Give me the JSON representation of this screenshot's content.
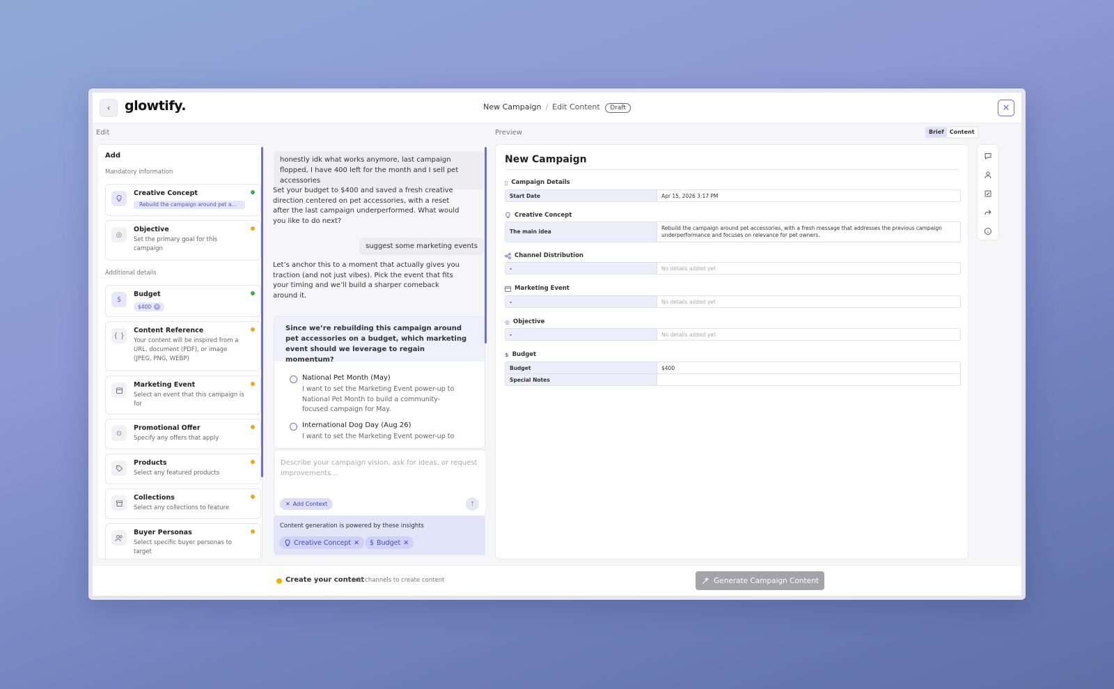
{
  "header": {
    "logo": "glowtify.",
    "breadcrumb_root": "New Campaign",
    "breadcrumb_sep": "/",
    "breadcrumb_current": "Edit Content",
    "status_badge": "Draft"
  },
  "panels": {
    "edit_label": "Edit",
    "preview_label": "Preview",
    "view_toggle": [
      "Brief",
      "Content"
    ],
    "view_toggle_selected": "Brief"
  },
  "sidebar": {
    "add_title": "Add",
    "mandatory_label": "Mandatory information",
    "additional_label": "Additional details",
    "items": [
      {
        "title": "Creative Concept",
        "chip": "Rebuild the campaign around pet accessories, with a fresh message",
        "status": "green",
        "icon": "lightbulb-icon"
      },
      {
        "title": "Objective",
        "desc": "Set the primary goal for this campaign",
        "status": "orange",
        "icon": "target-icon"
      },
      {
        "title": "Budget",
        "chip": "$400",
        "status": "green",
        "icon": "dollar-icon"
      },
      {
        "title": "Content Reference",
        "desc": "Your content will be inspired from a URL, document (PDF), or image (JPEG, PNG, WEBP)",
        "status": "orange",
        "icon": "braces-icon"
      },
      {
        "title": "Marketing Event",
        "desc": "Select an event that this campaign is for",
        "status": "orange",
        "icon": "calendar-icon"
      },
      {
        "title": "Promotional Offer",
        "desc": "Specify any offers that apply",
        "status": "orange",
        "icon": "badge-icon"
      },
      {
        "title": "Products",
        "desc": "Select any featured products",
        "status": "orange",
        "icon": "tag-icon"
      },
      {
        "title": "Collections",
        "desc": "Select any collections to feature",
        "status": "orange",
        "icon": "archive-icon"
      },
      {
        "title": "Buyer Personas",
        "desc": "Select specific buyer personas to target",
        "status": "orange",
        "icon": "users-icon"
      }
    ]
  },
  "chat": {
    "messages": [
      {
        "role": "user",
        "text": "honestly idk what works anymore, last campaign flopped, I have 400 left for the month and I sell pet accessories"
      },
      {
        "role": "assistant",
        "text": "Set your budget to $400 and saved a fresh creative direction centered on pet accessories, with a reset after the last campaign underperformed. What would you like to do next?"
      },
      {
        "role": "user",
        "text": "suggest some marketing events"
      },
      {
        "role": "assistant",
        "text": "Let’s anchor this to a moment that actually gives you traction (and not just vibes). Pick the event that fits your timing and we’ll build a sharper comeback around it."
      }
    ],
    "question": "Since we’re rebuilding this campaign around pet accessories on a budget, which marketing event should we leverage to regain momentum?",
    "options": [
      {
        "title": "National Pet Month (May)",
        "desc": "I want to set the Marketing Event power-up to National Pet Month to build a community-focused campaign for May."
      },
      {
        "title": "International Dog Day (Aug 26)",
        "desc": "I want to set the Marketing Event power-up to"
      }
    ],
    "composer_placeholder": "Describe your campaign vision, ask for ideas, or request improvements...",
    "add_context_label": "Add Context",
    "insights_title": "Content generation is powered by these insights",
    "insight_chips": [
      "Creative Concept",
      "Budget"
    ]
  },
  "preview": {
    "title": "New Campaign",
    "sections": [
      {
        "heading": "Campaign Details",
        "icon": "document-icon",
        "rows": [
          {
            "key": "Start Date",
            "value": "Apr 15, 2026 3:17 PM"
          }
        ]
      },
      {
        "heading": "Creative Concept",
        "icon": "lightbulb-icon",
        "rows": [
          {
            "key": "The main idea",
            "value": "Rebuild the campaign around pet accessories, with a fresh message that addresses the previous campaign underperformance and focuses on relevance for pet owners."
          }
        ]
      },
      {
        "heading": "Channel Distribution",
        "icon": "share-icon",
        "rows": [
          {
            "key": "-",
            "value": "No details added yet"
          }
        ]
      },
      {
        "heading": "Marketing Event",
        "icon": "calendar-icon",
        "rows": [
          {
            "key": "-",
            "value": "No details added yet"
          }
        ]
      },
      {
        "heading": "Objective",
        "icon": "target-icon",
        "rows": [
          {
            "key": "-",
            "value": "No details added yet"
          }
        ]
      },
      {
        "heading": "Budget",
        "icon": "dollar-icon",
        "rows": [
          {
            "key": "Budget",
            "value": "$400"
          },
          {
            "key": "Special Notes",
            "value": ""
          }
        ]
      }
    ]
  },
  "rail_icons": [
    "chat-icon",
    "person-icon",
    "checklist-icon",
    "share-arrow-icon",
    "info-icon"
  ],
  "footer": {
    "status_title": "Create your content",
    "status_sub": "Add channels to create content",
    "generate_label": "Generate Campaign Content"
  },
  "colors": {
    "accent": "#6b6fd6",
    "status_green": "#34b34a",
    "status_orange": "#f3a219",
    "status_yellow": "#f0b400"
  }
}
